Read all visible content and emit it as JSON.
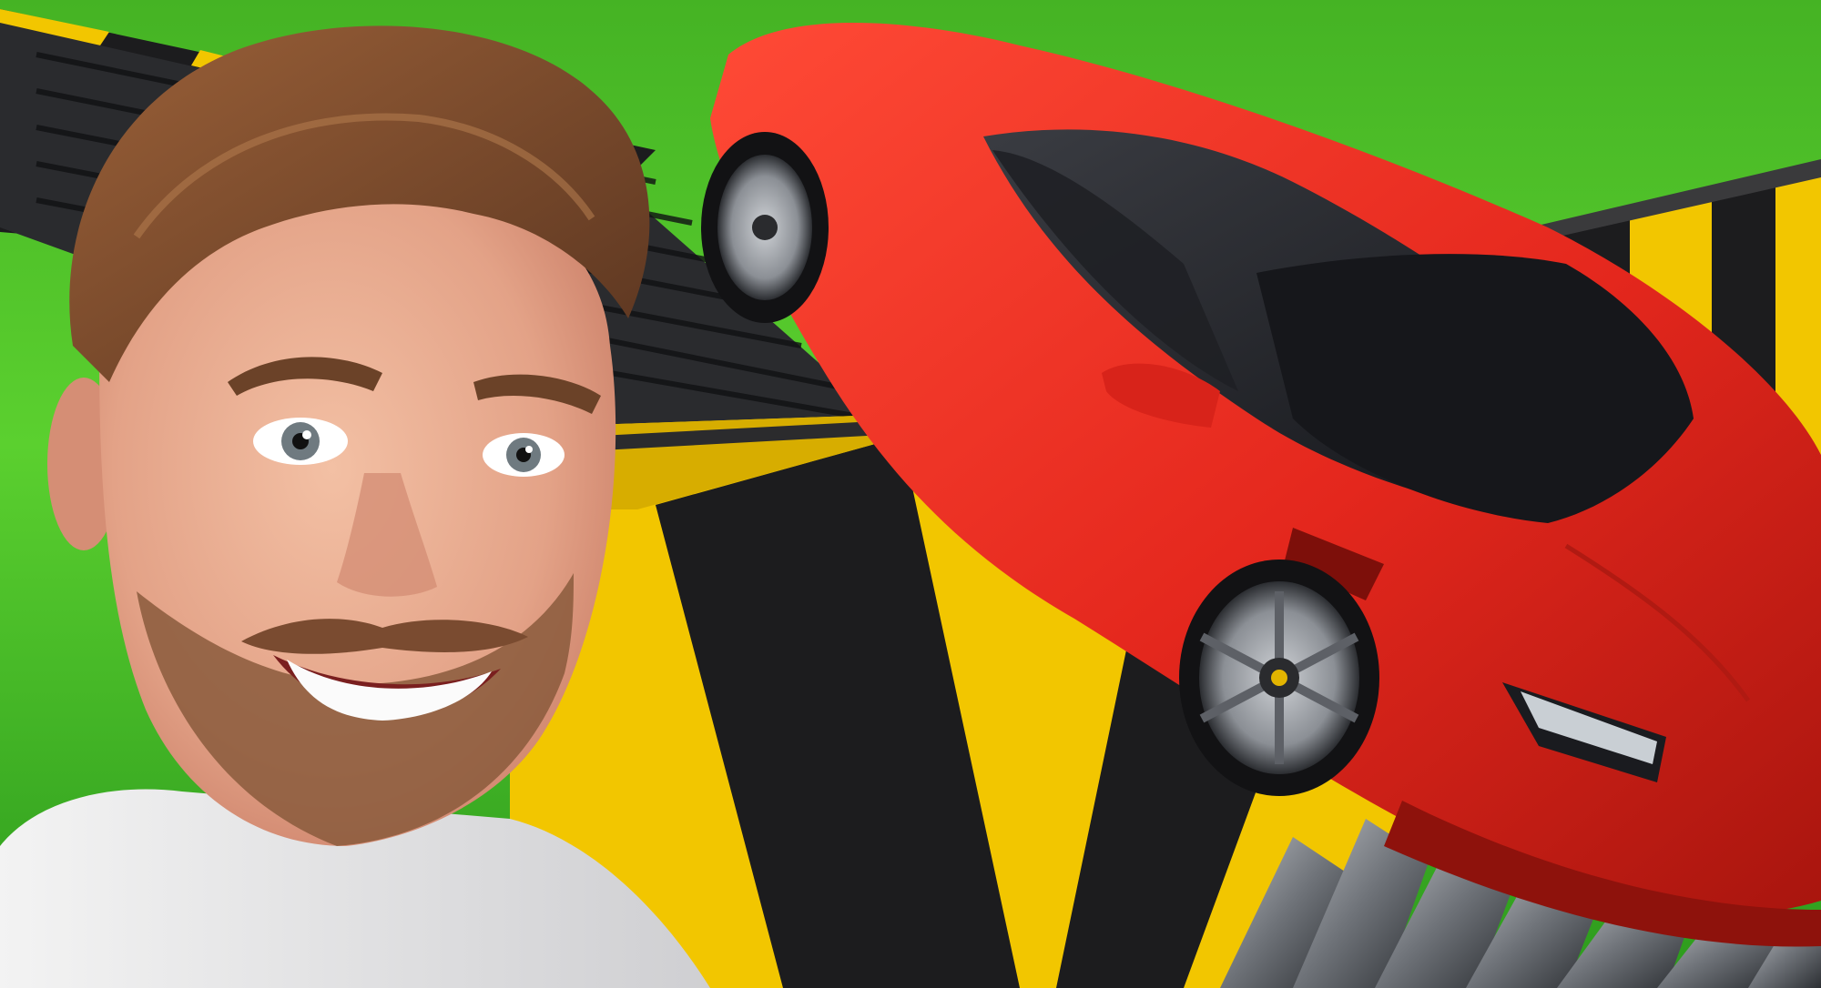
{
  "scene": {
    "subject": "person",
    "object": "red sports car",
    "machine": "shredder"
  },
  "colors": {
    "grass_light": "#54c82b",
    "grass_dark": "#1f8c16",
    "car_red": "#e4271d",
    "car_dark": "#9c150f",
    "hazard_yellow": "#f2c600",
    "hazard_black": "#1c1c1e",
    "skin": "#e8a88c",
    "hair": "#7a4a2c",
    "shirt": "#e9e9ea"
  }
}
